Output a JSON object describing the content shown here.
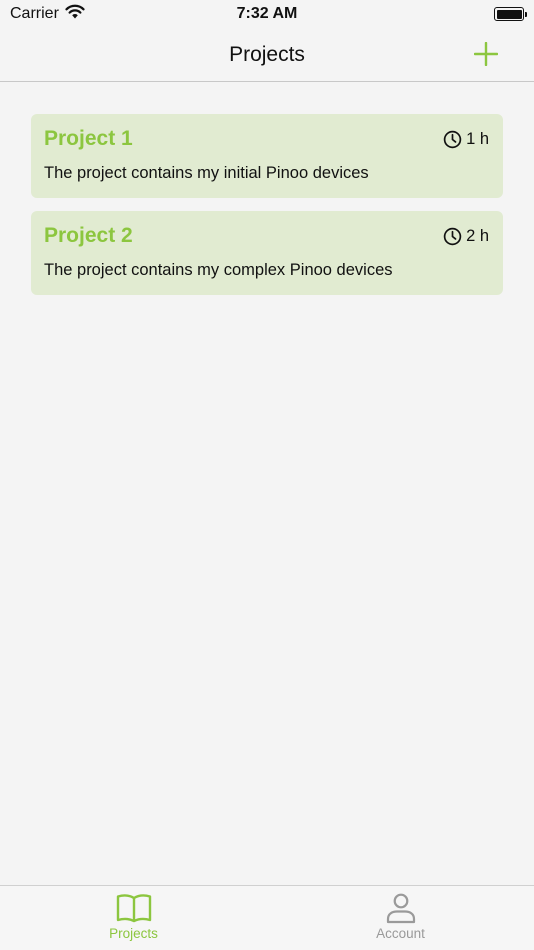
{
  "status_bar": {
    "carrier": "Carrier",
    "time": "7:32 AM"
  },
  "nav": {
    "title": "Projects",
    "add_icon": "plus-icon"
  },
  "projects": [
    {
      "name": "Project 1",
      "duration": "1 h",
      "description": "The project contains my initial Pinoo devices"
    },
    {
      "name": "Project 2",
      "duration": "2 h",
      "description": "The project contains my complex Pinoo devices"
    }
  ],
  "tabs": [
    {
      "label": "Projects",
      "icon": "book-icon",
      "active": true
    },
    {
      "label": "Account",
      "icon": "person-icon",
      "active": false
    }
  ],
  "colors": {
    "accent": "#8cc63f",
    "card_bg": "#e1ebd1",
    "inactive": "#9a9a9a"
  }
}
